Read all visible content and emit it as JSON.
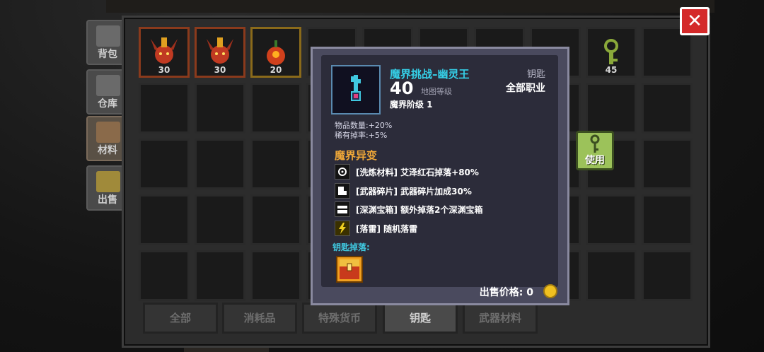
{
  "side_tabs": [
    {
      "label": "背包",
      "icon": "backpack-icon"
    },
    {
      "label": "仓库",
      "icon": "warehouse-icon"
    },
    {
      "label": "材料",
      "icon": "materials-icon"
    },
    {
      "label": "出售",
      "icon": "sell-icon"
    }
  ],
  "grid_quantities": {
    "slot1": "30",
    "slot2": "30",
    "slot3": "20",
    "slot9": "45"
  },
  "bottom_tabs": [
    "全部",
    "消耗品",
    "特殊货币",
    "钥匙",
    "武器材料"
  ],
  "active_bottom_tab": "钥匙",
  "close_button": {
    "label": "✕"
  },
  "use_button": {
    "label": "使用"
  },
  "tooltip": {
    "name": "魔界挑战–幽灵王",
    "type": "钥匙",
    "level": "40",
    "level_label": "地图等级",
    "class": "全部职业",
    "tier": "魔界阶级 1",
    "stats": [
      "物品数量:+20%",
      "稀有掉率:+5%"
    ],
    "section_title": "魔界异变",
    "modifiers": [
      {
        "icon": "gear-icon",
        "text": "[洗炼材料] 艾泽红石掉落+80%"
      },
      {
        "icon": "shard-icon",
        "text": "[武器碎片] 武器碎片加成30%"
      },
      {
        "icon": "chest-icon",
        "text": "[深渊宝箱] 额外掉落2个深渊宝箱"
      },
      {
        "icon": "lightning-icon",
        "text": "[落雷] 随机落雷"
      }
    ],
    "drop_label": "钥匙掉落:",
    "price": "出售价格: 0"
  },
  "colors": {
    "name": "#35d0e8",
    "section": "#f0a838",
    "drop": "#40c8e0",
    "close": "#d42a2a",
    "use": "#9cc25a"
  }
}
